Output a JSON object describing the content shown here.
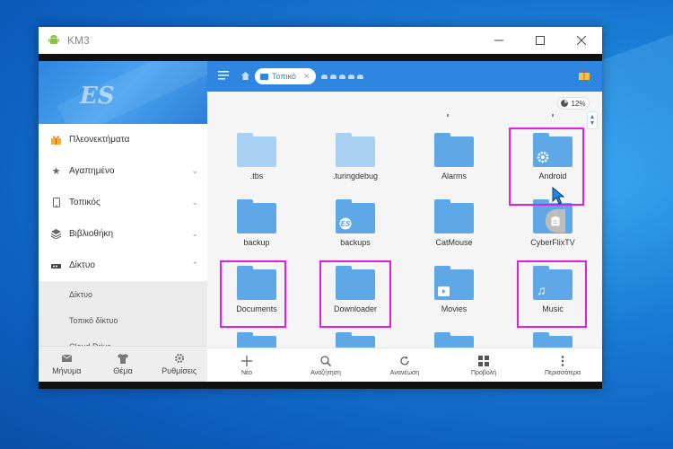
{
  "window": {
    "title": "KM3",
    "controls": [
      "minimize",
      "maximize",
      "close"
    ]
  },
  "sidebar": {
    "logo": "ES",
    "items": [
      {
        "label": "Πλεονεκτήματα",
        "icon": "gift-icon",
        "chevron": ""
      },
      {
        "label": "Αγαπημένο",
        "icon": "star-icon",
        "chevron": "⌄"
      },
      {
        "label": "Τοπικός",
        "icon": "phone-icon",
        "chevron": "⌄"
      },
      {
        "label": "Βιβλιοθήκη",
        "icon": "layers-icon",
        "chevron": "⌄"
      },
      {
        "label": "Δίκτυο",
        "icon": "network-icon",
        "chevron": "⌃"
      }
    ],
    "subitems": [
      "Δίκτυο",
      "Τοπικό δίκτυο",
      "Cloud Drive"
    ],
    "bottom": [
      {
        "label": "Μήνυμα",
        "icon": "mail-icon"
      },
      {
        "label": "Θέμα",
        "icon": "shirt-icon"
      },
      {
        "label": "Ρυθμίσεις",
        "icon": "gear-icon"
      }
    ]
  },
  "topbar": {
    "path_label": "Τοπικό",
    "usage": "12%"
  },
  "files": [
    {
      "name": ".tbs",
      "style": "light",
      "badge": ""
    },
    {
      "name": ".turingdebug",
      "style": "light",
      "badge": ""
    },
    {
      "name": "Alarms",
      "style": "dark",
      "badge": ""
    },
    {
      "name": "Android",
      "style": "dark",
      "badge": "gear"
    },
    {
      "name": "backup",
      "style": "dark",
      "badge": ""
    },
    {
      "name": "backups",
      "style": "dark",
      "badge": "es"
    },
    {
      "name": "CatMouse",
      "style": "dark",
      "badge": ""
    },
    {
      "name": "CyberFlixTV",
      "style": "dark",
      "badge": ""
    },
    {
      "name": "Documents",
      "style": "dark",
      "badge": ""
    },
    {
      "name": "Downloader",
      "style": "dark",
      "badge": ""
    },
    {
      "name": "Movies",
      "style": "dark",
      "badge": "play"
    },
    {
      "name": "Music",
      "style": "dark",
      "badge": "note"
    }
  ],
  "bottombar": [
    {
      "label": "Νέο",
      "icon": "plus-icon"
    },
    {
      "label": "Αναζήτηση",
      "icon": "search-icon"
    },
    {
      "label": "Ανανέωση",
      "icon": "refresh-icon"
    },
    {
      "label": "Προβολή",
      "icon": "grid-view-icon"
    },
    {
      "label": "Περισσότερα",
      "icon": "more-vertical-icon"
    }
  ],
  "colors": {
    "accent": "#2f86e0",
    "folder": "#5fa8e8",
    "folder_hidden": "#a8d0f3",
    "highlight": "#e020e0"
  }
}
